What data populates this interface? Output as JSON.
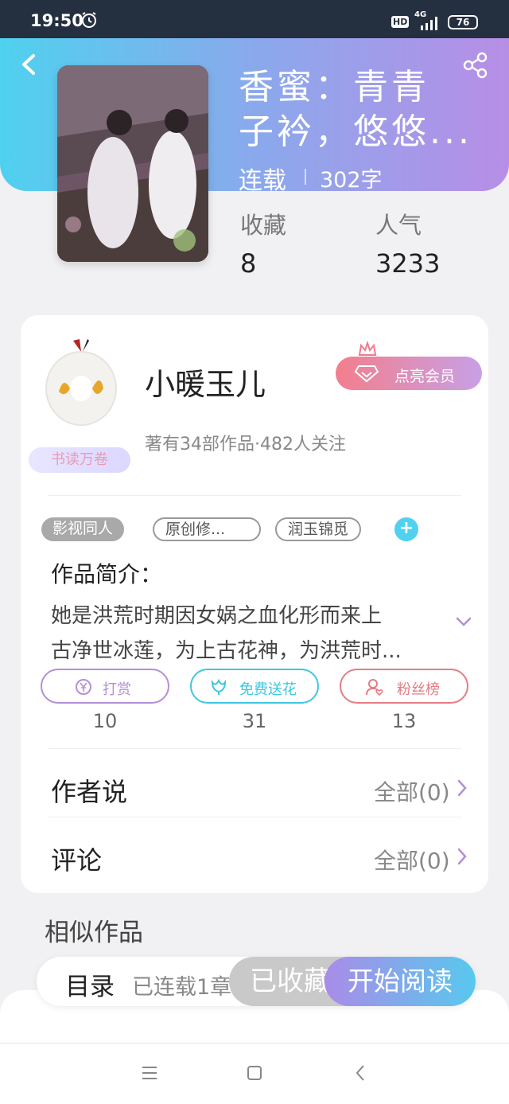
{
  "status_bar": {
    "time": "19:50",
    "hd": "HD",
    "network": "4G",
    "battery": "76"
  },
  "book": {
    "title_line1": "香蜜：青青",
    "title_line2": "子衿，悠悠...",
    "status": "连载",
    "words": "302字",
    "stats": [
      {
        "label": "收藏",
        "value": "8"
      },
      {
        "label": "人气",
        "value": "3233"
      }
    ]
  },
  "author": {
    "name": "小暖玉儿",
    "badge": "书读万卷",
    "meta": "著有34部作品·482人关注",
    "vip_button": "点亮会员"
  },
  "tags": [
    "影视同人",
    "原创修...",
    "润玉锦觅"
  ],
  "intro": {
    "title": "作品简介：",
    "line1": "她是洪荒时期因女娲之血化形而来上",
    "line2": "古净世冰莲，为上古花神，为洪荒时..."
  },
  "actions": [
    {
      "label": "打赏",
      "count": "10",
      "color": "#b48fd8",
      "icon": "coin-icon"
    },
    {
      "label": "免费送花",
      "count": "31",
      "color": "#3ec7e0",
      "icon": "flower-icon"
    },
    {
      "label": "粉丝榜",
      "count": "13",
      "color": "#e67c84",
      "icon": "fans-icon"
    }
  ],
  "rows": [
    {
      "label": "作者说",
      "value": "全部(0)"
    },
    {
      "label": "评论",
      "value": "全部(0)"
    }
  ],
  "similar_title": "相似作品",
  "bottom": {
    "toc_label": "目录",
    "toc_status": "已连载1章",
    "favorite": "已收藏",
    "start_reading": "开始阅读"
  },
  "colors": {
    "header_gradient_start": "#4fd1ef",
    "header_gradient_end": "#b78ee6",
    "accent": "#4fd1ef"
  }
}
